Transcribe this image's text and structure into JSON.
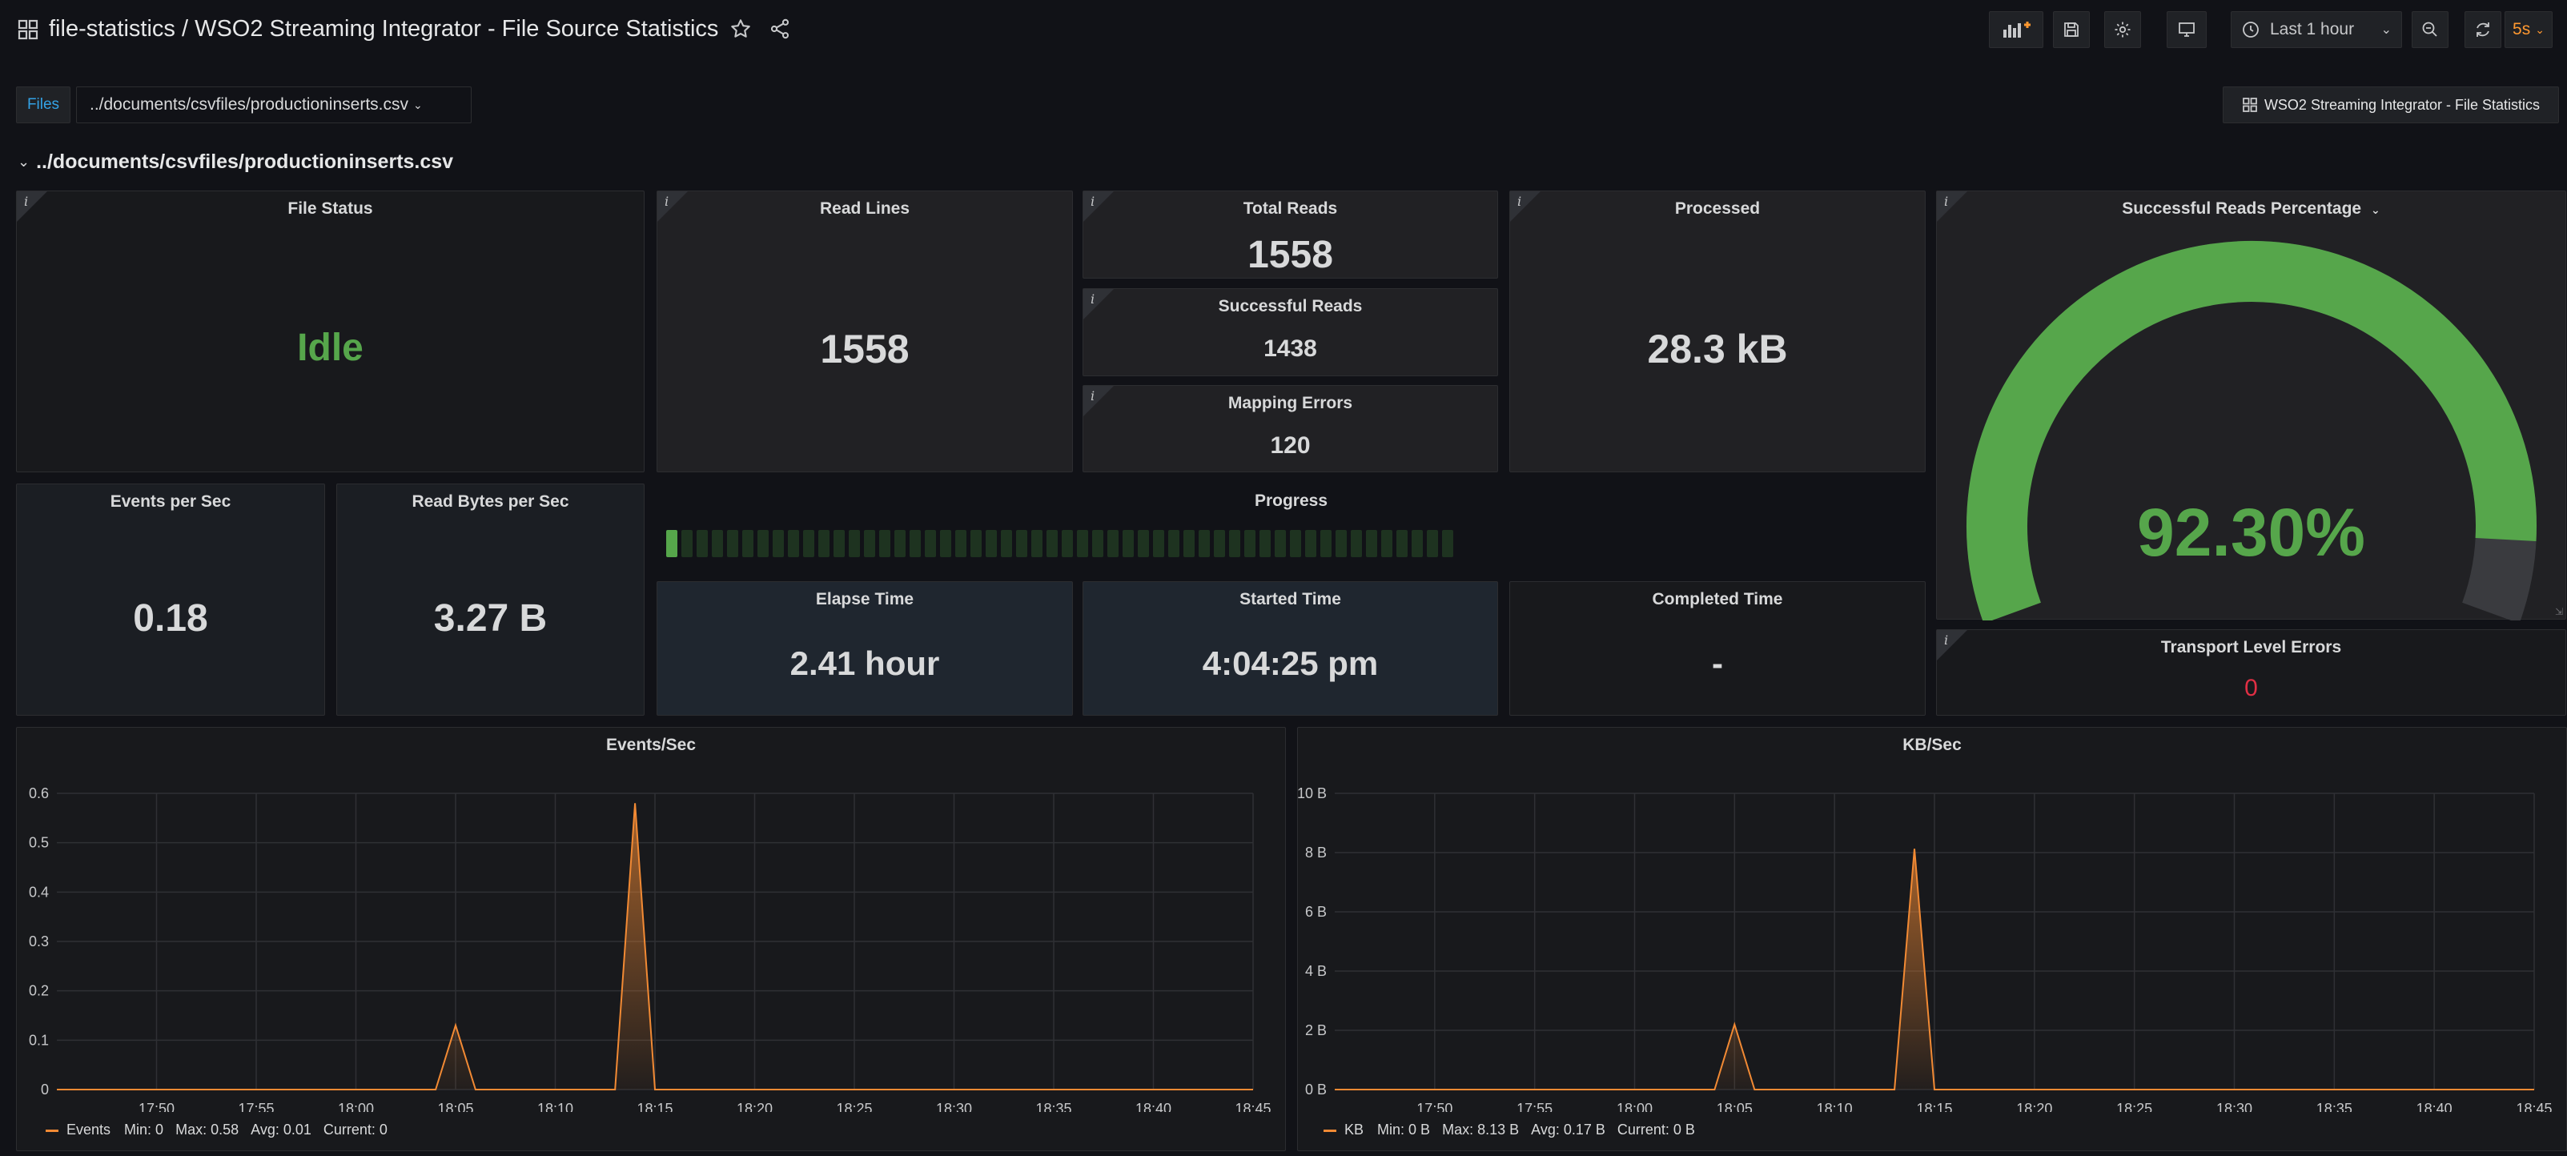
{
  "header": {
    "title": "file-statistics / WSO2 Streaming Integrator - File Source Statistics",
    "time_range": "Last 1 hour",
    "refresh_interval": "5s"
  },
  "variables": {
    "files_label": "Files",
    "files_value": "../documents/csvfiles/productioninserts.csv",
    "dashboard_link": "WSO2 Streaming Integrator - File Statistics"
  },
  "row": {
    "title": "../documents/csvfiles/productioninserts.csv"
  },
  "panels": {
    "file_status": {
      "title": "File Status",
      "value": "Idle"
    },
    "read_lines": {
      "title": "Read Lines",
      "value": "1558"
    },
    "total_reads": {
      "title": "Total Reads",
      "value": "1558"
    },
    "successful_reads": {
      "title": "Successful Reads",
      "value": "1438"
    },
    "mapping_errors": {
      "title": "Mapping Errors",
      "value": "120"
    },
    "processed": {
      "title": "Processed",
      "value": "28.3 kB"
    },
    "success_pct": {
      "title": "Successful Reads Percentage",
      "value": "92.30%",
      "fraction": 0.923
    },
    "events_per_sec": {
      "title": "Events per Sec",
      "value": "0.18"
    },
    "read_bytes_per_sec": {
      "title": "Read Bytes per Sec",
      "value": "3.27 B"
    },
    "progress": {
      "title": "Progress",
      "segments_filled": 1,
      "segments_total": 52
    },
    "elapse_time": {
      "title": "Elapse Time",
      "value": "2.41 hour"
    },
    "started_time": {
      "title": "Started Time",
      "value": "4:04:25 pm"
    },
    "completed_time": {
      "title": "Completed Time",
      "value": "-"
    },
    "transport_errors": {
      "title": "Transport Level Errors",
      "value": "0"
    }
  },
  "colors": {
    "green": "#56a64b",
    "orange": "#f28a34",
    "red": "#e02f44",
    "accent": "#ff9830"
  },
  "chart_data": [
    {
      "type": "area",
      "title": "Events/Sec",
      "x": [
        "17:45",
        "17:50",
        "17:55",
        "18:00",
        "18:05",
        "18:10",
        "18:15",
        "18:20",
        "18:25",
        "18:30",
        "18:35",
        "18:40",
        "18:45"
      ],
      "xticks": [
        "17:50",
        "17:55",
        "18:00",
        "18:05",
        "18:10",
        "18:15",
        "18:20",
        "18:25",
        "18:30",
        "18:35",
        "18:40",
        "18:45"
      ],
      "yticks": [
        "0",
        "0.1",
        "0.2",
        "0.3",
        "0.4",
        "0.5",
        "0.6"
      ],
      "ylim": [
        0,
        0.6
      ],
      "series": [
        {
          "name": "Events",
          "points": [
            [
              "17:45",
              0
            ],
            [
              "18:04",
              0
            ],
            [
              "18:05",
              0.13
            ],
            [
              "18:06",
              0
            ],
            [
              "18:13",
              0
            ],
            [
              "18:14",
              0.58
            ],
            [
              "18:15",
              0
            ],
            [
              "18:45",
              0
            ]
          ]
        }
      ],
      "legend": {
        "min": "Min: 0",
        "max": "Max: 0.58",
        "avg": "Avg: 0.01",
        "current": "Current: 0"
      }
    },
    {
      "type": "area",
      "title": "KB/Sec",
      "x": [
        "17:45",
        "17:50",
        "17:55",
        "18:00",
        "18:05",
        "18:10",
        "18:15",
        "18:20",
        "18:25",
        "18:30",
        "18:35",
        "18:40",
        "18:45"
      ],
      "xticks": [
        "17:50",
        "17:55",
        "18:00",
        "18:05",
        "18:10",
        "18:15",
        "18:20",
        "18:25",
        "18:30",
        "18:35",
        "18:40",
        "18:45"
      ],
      "yticks": [
        "0 B",
        "2 B",
        "4 B",
        "6 B",
        "8 B",
        "10 B"
      ],
      "ylim": [
        0,
        10
      ],
      "series": [
        {
          "name": "KB",
          "points": [
            [
              "17:45",
              0
            ],
            [
              "18:04",
              0
            ],
            [
              "18:05",
              2.2
            ],
            [
              "18:06",
              0
            ],
            [
              "18:13",
              0
            ],
            [
              "18:14",
              8.13
            ],
            [
              "18:15",
              0
            ],
            [
              "18:45",
              0
            ]
          ]
        }
      ],
      "legend": {
        "min": "Min: 0 B",
        "max": "Max: 8.13 B",
        "avg": "Avg: 0.17 B",
        "current": "Current: 0 B"
      }
    }
  ]
}
